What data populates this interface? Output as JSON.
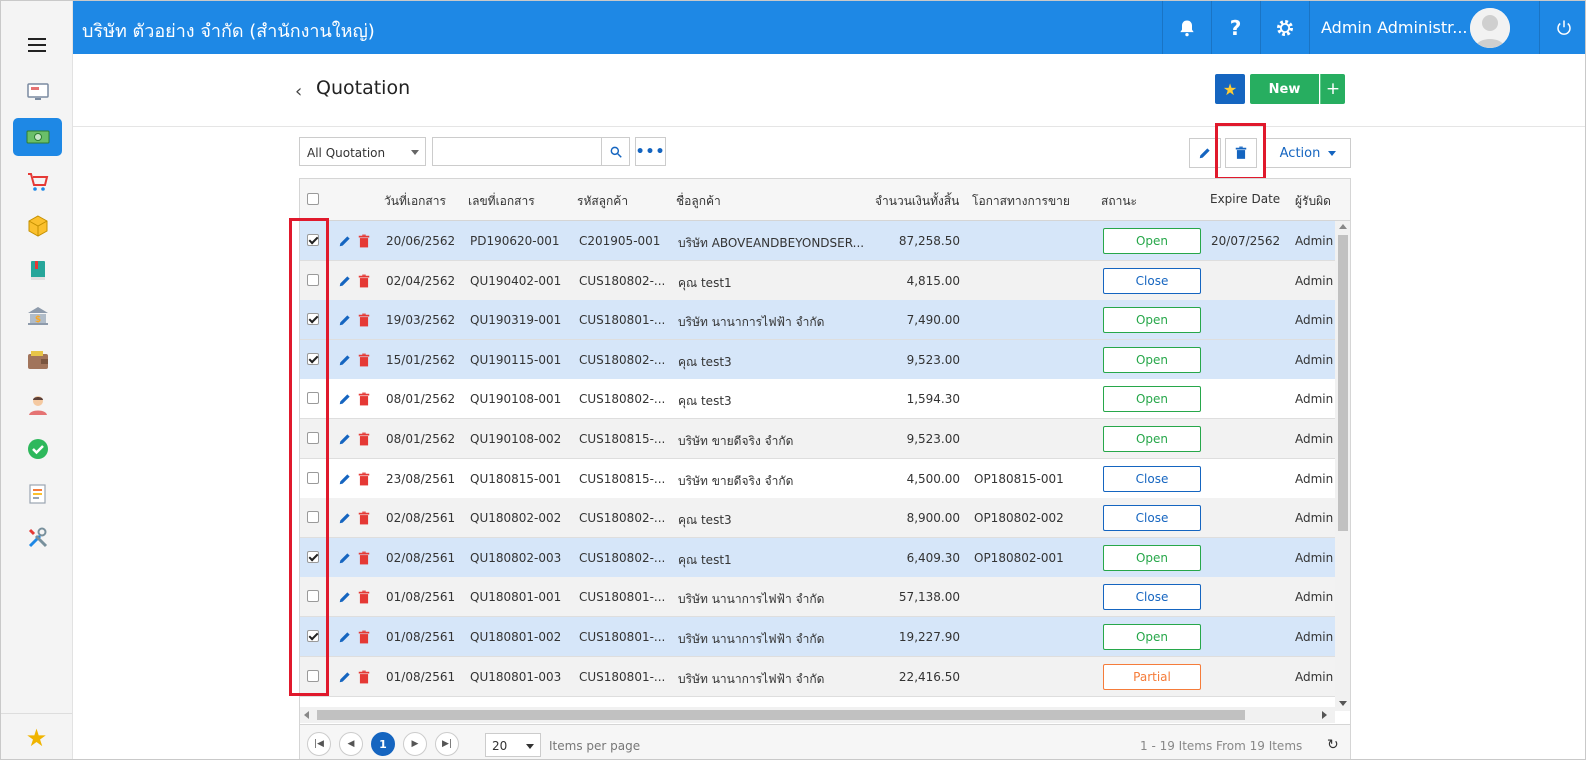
{
  "header": {
    "company": "บริษัท ตัวอย่าง จำกัด (สำนักงานใหญ่)",
    "user_name": "Admin Administr...",
    "help_label": "?"
  },
  "sidebar": {
    "icons": [
      "display-icon",
      "cash-icon",
      "cart-icon",
      "box-icon",
      "book-icon",
      "bank-icon",
      "wallet-icon",
      "people-icon",
      "check-icon",
      "document-icon",
      "tools-icon"
    ],
    "active_index": 1,
    "favorite_icon": "star-icon"
  },
  "page": {
    "title": "Quotation",
    "new_label": "New",
    "plus_label": "+"
  },
  "toolbar": {
    "filter_value": "All Quotation",
    "search_value": "",
    "more_label": "•••",
    "action_label": "Action"
  },
  "columns": {
    "date": "วันที่เอกสาร",
    "doc_no": "เลขที่เอกสาร",
    "customer_code": "รหัสลูกค้า",
    "customer_name": "ชื่อลูกค้า",
    "total": "จำนวนเงินทั้งสิ้น",
    "opportunity": "โอกาสทางการขาย",
    "status": "สถานะ",
    "expire": "Expire Date",
    "owner": "ผู้รับผิด"
  },
  "rows": [
    {
      "checked": true,
      "date": "20/06/2562",
      "doc_no": "PD190620-001",
      "customer_code": "C201905-001",
      "customer_name": "บริษัท ABOVEANDBEYONDSER...",
      "total": "87,258.50",
      "opportunity": "",
      "status": "Open",
      "expire": "20/07/2562",
      "owner": "Admin"
    },
    {
      "checked": false,
      "date": "02/04/2562",
      "doc_no": "QU190402-001",
      "customer_code": "CUS180802-...",
      "customer_name": "คุณ test1",
      "total": "4,815.00",
      "opportunity": "",
      "status": "Close",
      "expire": "",
      "owner": "Admin"
    },
    {
      "checked": true,
      "date": "19/03/2562",
      "doc_no": "QU190319-001",
      "customer_code": "CUS180801-...",
      "customer_name": "บริษัท นานาการไฟฟ้า จำกัด",
      "total": "7,490.00",
      "opportunity": "",
      "status": "Open",
      "expire": "",
      "owner": "Admin"
    },
    {
      "checked": true,
      "date": "15/01/2562",
      "doc_no": "QU190115-001",
      "customer_code": "CUS180802-...",
      "customer_name": "คุณ test3",
      "total": "9,523.00",
      "opportunity": "",
      "status": "Open",
      "expire": "",
      "owner": "Admin"
    },
    {
      "checked": false,
      "date": "08/01/2562",
      "doc_no": "QU190108-001",
      "customer_code": "CUS180802-...",
      "customer_name": "คุณ test3",
      "total": "1,594.30",
      "opportunity": "",
      "status": "Open",
      "expire": "",
      "owner": "Admin"
    },
    {
      "checked": false,
      "date": "08/01/2562",
      "doc_no": "QU190108-002",
      "customer_code": "CUS180815-...",
      "customer_name": "บริษัท ขายดีจริง จำกัด",
      "total": "9,523.00",
      "opportunity": "",
      "status": "Open",
      "expire": "",
      "owner": "Admin"
    },
    {
      "checked": false,
      "date": "23/08/2561",
      "doc_no": "QU180815-001",
      "customer_code": "CUS180815-...",
      "customer_name": "บริษัท ขายดีจริง จำกัด",
      "total": "4,500.00",
      "opportunity": "OP180815-001",
      "status": "Close",
      "expire": "",
      "owner": "Admin"
    },
    {
      "checked": false,
      "date": "02/08/2561",
      "doc_no": "QU180802-002",
      "customer_code": "CUS180802-...",
      "customer_name": "คุณ test3",
      "total": "8,900.00",
      "opportunity": "OP180802-002",
      "status": "Close",
      "expire": "",
      "owner": "Admin"
    },
    {
      "checked": true,
      "date": "02/08/2561",
      "doc_no": "QU180802-003",
      "customer_code": "CUS180802-...",
      "customer_name": "คุณ test1",
      "total": "6,409.30",
      "opportunity": "OP180802-001",
      "status": "Open",
      "expire": "",
      "owner": "Admin"
    },
    {
      "checked": false,
      "date": "01/08/2561",
      "doc_no": "QU180801-001",
      "customer_code": "CUS180801-...",
      "customer_name": "บริษัท นานาการไฟฟ้า จำกัด",
      "total": "57,138.00",
      "opportunity": "",
      "status": "Close",
      "expire": "",
      "owner": "Admin"
    },
    {
      "checked": true,
      "date": "01/08/2561",
      "doc_no": "QU180801-002",
      "customer_code": "CUS180801-...",
      "customer_name": "บริษัท นานาการไฟฟ้า จำกัด",
      "total": "19,227.90",
      "opportunity": "",
      "status": "Open",
      "expire": "",
      "owner": "Admin"
    },
    {
      "checked": false,
      "date": "01/08/2561",
      "doc_no": "QU180801-003",
      "customer_code": "CUS180801-...",
      "customer_name": "บริษัท นานาการไฟฟ้า จำกัด",
      "total": "22,416.50",
      "opportunity": "",
      "status": "Partial",
      "expire": "",
      "owner": "Admin"
    }
  ],
  "status_colors": {
    "Open": "#27a74a",
    "Close": "#1565c0",
    "Partial": "#f57c3a"
  },
  "pager": {
    "current_page": "1",
    "page_size": "20",
    "items_per_page_label": "Items per page",
    "range_text": "1 - 19 Items From 19 Items"
  }
}
